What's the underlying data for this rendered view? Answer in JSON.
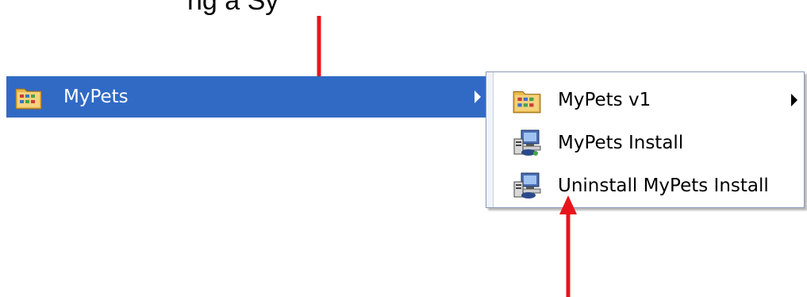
{
  "caption": {
    "fragment": "ng a Sy"
  },
  "start_menu": {
    "selected_item": {
      "label": "MyPets",
      "icon": "program-folder-icon",
      "has_submenu": true
    }
  },
  "submenu": {
    "items": [
      {
        "label": "MyPets v1",
        "icon": "program-folder-icon",
        "has_submenu": true
      },
      {
        "label": "MyPets Install",
        "icon": "installer-icon",
        "has_submenu": false
      },
      {
        "label": "Uninstall MyPets Install",
        "icon": "installer-icon",
        "has_submenu": false
      }
    ]
  },
  "colors": {
    "selection": "#316ac5",
    "annotation_arrow": "#e8141b"
  }
}
